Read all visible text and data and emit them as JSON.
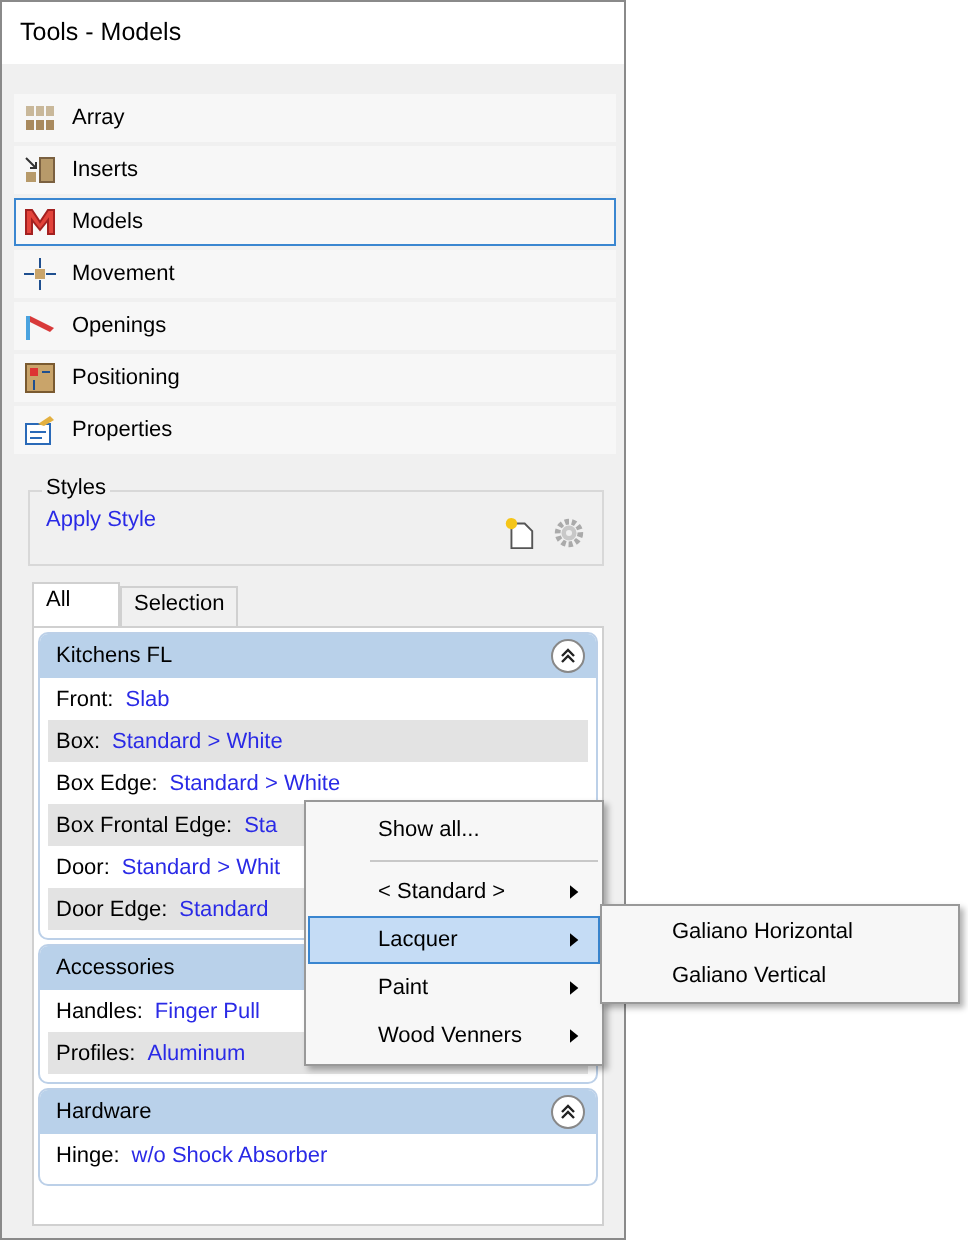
{
  "window": {
    "title": "Tools - Models"
  },
  "sidebar": {
    "items": [
      {
        "label": "Array",
        "selected": false
      },
      {
        "label": "Inserts",
        "selected": false
      },
      {
        "label": "Models",
        "selected": true
      },
      {
        "label": "Movement",
        "selected": false
      },
      {
        "label": "Openings",
        "selected": false
      },
      {
        "label": "Positioning",
        "selected": false
      },
      {
        "label": "Properties",
        "selected": false
      }
    ]
  },
  "styles": {
    "title": "Styles",
    "link": "Apply Style"
  },
  "tabs": [
    {
      "label": "All",
      "selected": true
    },
    {
      "label": "Selection",
      "selected": false
    }
  ],
  "groups": [
    {
      "title": "Kitchens FL",
      "rows": [
        {
          "label": "Front:",
          "value": "Slab"
        },
        {
          "label": "Box:",
          "value": "Standard > White"
        },
        {
          "label": "Box Edge:",
          "value": "Standard > White"
        },
        {
          "label": "Box Frontal Edge:",
          "value": "Sta"
        },
        {
          "label": "Door:",
          "value": "Standard > Whit"
        },
        {
          "label": "Door Edge:",
          "value": "Standard"
        }
      ]
    },
    {
      "title": "Accessories",
      "rows": [
        {
          "label": "Handles:",
          "value": "Finger Pull"
        },
        {
          "label": "Profiles:",
          "value": "Aluminum"
        }
      ]
    },
    {
      "title": "Hardware",
      "rows": [
        {
          "label": "Hinge:",
          "value": "w/o Shock Absorber"
        }
      ]
    }
  ],
  "context_menu": {
    "items": [
      {
        "kind": "item",
        "label": "Show all...",
        "has_submenu": false,
        "selected": false
      },
      {
        "kind": "separator"
      },
      {
        "kind": "item",
        "label": "< Standard >",
        "has_submenu": true,
        "selected": false
      },
      {
        "kind": "item",
        "label": "Lacquer",
        "has_submenu": true,
        "selected": true
      },
      {
        "kind": "item",
        "label": "Paint",
        "has_submenu": true,
        "selected": false
      },
      {
        "kind": "item",
        "label": "Wood Venners",
        "has_submenu": true,
        "selected": false
      }
    ]
  },
  "submenu": {
    "items": [
      {
        "label": "Galiano Horizontal"
      },
      {
        "label": "Galiano Vertical"
      }
    ]
  }
}
